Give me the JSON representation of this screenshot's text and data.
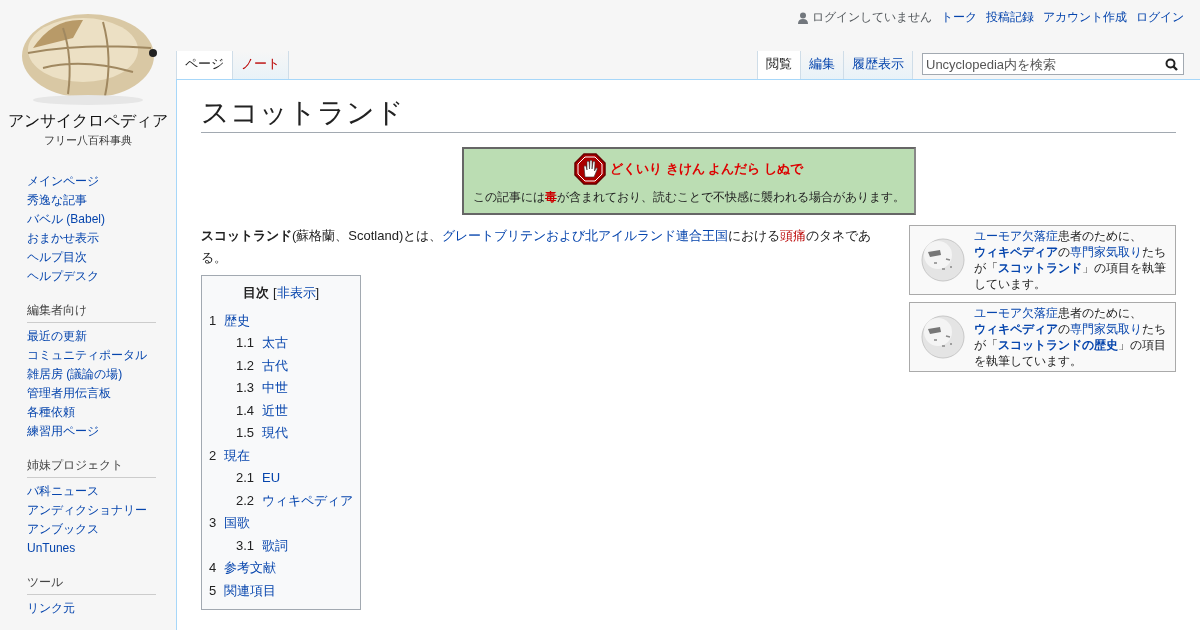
{
  "logo": {
    "title": "アンサイクロペディア",
    "subtitle": "フリー八百科事典"
  },
  "personal_tools": [
    {
      "label": "ログインしていません",
      "kind": "status"
    },
    {
      "label": "トーク",
      "kind": "link"
    },
    {
      "label": "投稿記録",
      "kind": "link"
    },
    {
      "label": "アカウント作成",
      "kind": "link"
    },
    {
      "label": "ログイン",
      "kind": "link"
    }
  ],
  "namespace_tabs": [
    {
      "label": "ページ",
      "selected": true,
      "exists": true
    },
    {
      "label": "ノート",
      "selected": false,
      "exists": false
    }
  ],
  "view_tabs": [
    {
      "label": "閲覧",
      "selected": true
    },
    {
      "label": "編集",
      "selected": false
    },
    {
      "label": "履歴表示",
      "selected": false
    }
  ],
  "search": {
    "placeholder": "Uncyclopedia内を検索"
  },
  "sidebar": {
    "main": [
      "メインページ",
      "秀逸な記事",
      "バベル (Babel)",
      "おまかせ表示",
      "ヘルプ目次",
      "ヘルプデスク"
    ],
    "sections": [
      {
        "heading": "編集者向け",
        "items": [
          "最近の更新",
          "コミュニティポータル",
          "雑居房 (議論の場)",
          "管理者用伝言板",
          "各種依頼",
          "練習用ページ"
        ]
      },
      {
        "heading": "姉妹プロジェクト",
        "items": [
          "バ科ニュース",
          "アンディクショナリー",
          "アンブックス",
          "UnTunes"
        ]
      },
      {
        "heading": "ツール",
        "items": [
          "リンク元"
        ]
      }
    ]
  },
  "title": "スコットランド",
  "warning": {
    "heading": "どくいり きけん よんだら しぬで",
    "text": "この記事には**毒**が含まれており、読むことで不快感に襲われる場合があります。"
  },
  "intro": [
    {
      "text": "スコットランド",
      "kind": "bold"
    },
    {
      "text": "(蘇格蘭、Scotland)とは、",
      "kind": "plain"
    },
    {
      "text": "グレートブリテンおよび北アイルランド連合王国",
      "kind": "link"
    },
    {
      "text": "における",
      "kind": "plain"
    },
    {
      "text": "頭痛",
      "kind": "redlink"
    },
    {
      "text": "のタネである。",
      "kind": "plain"
    }
  ],
  "notices": [
    [
      {
        "text": "ユーモア欠落症",
        "kind": "link"
      },
      {
        "text": "患者のために、",
        "kind": "plain"
      },
      {
        "text": "ウィキペディア",
        "kind": "boldlink"
      },
      {
        "text": "の",
        "kind": "plain"
      },
      {
        "text": "専門家気取り",
        "kind": "link"
      },
      {
        "text": "たちが「",
        "kind": "plain"
      },
      {
        "text": "スコットランド",
        "kind": "boldlink"
      },
      {
        "text": "」の項目を執筆しています。",
        "kind": "plain"
      }
    ],
    [
      {
        "text": "ユーモア欠落症",
        "kind": "link"
      },
      {
        "text": "患者のために、",
        "kind": "plain"
      },
      {
        "text": "ウィキペディア",
        "kind": "boldlink"
      },
      {
        "text": "の",
        "kind": "plain"
      },
      {
        "text": "専門家気取り",
        "kind": "link"
      },
      {
        "text": "たちが「",
        "kind": "plain"
      },
      {
        "text": "スコットランドの歴史",
        "kind": "boldlink"
      },
      {
        "text": "」の項目を執筆しています。",
        "kind": "plain"
      }
    ]
  ],
  "toc": {
    "title": "目次",
    "toggle_open": "[",
    "toggle": "非表示",
    "toggle_close": "]",
    "items": [
      {
        "number": "1",
        "text": "歴史",
        "children": [
          {
            "number": "1.1",
            "text": "太古"
          },
          {
            "number": "1.2",
            "text": "古代"
          },
          {
            "number": "1.3",
            "text": "中世"
          },
          {
            "number": "1.4",
            "text": "近世"
          },
          {
            "number": "1.5",
            "text": "現代"
          }
        ]
      },
      {
        "number": "2",
        "text": "現在",
        "children": [
          {
            "number": "2.1",
            "text": "EU"
          },
          {
            "number": "2.2",
            "text": "ウィキペディア"
          }
        ]
      },
      {
        "number": "3",
        "text": "国歌",
        "children": [
          {
            "number": "3.1",
            "text": "歌詞"
          }
        ]
      },
      {
        "number": "4",
        "text": "参考文献"
      },
      {
        "number": "5",
        "text": "関連項目"
      }
    ]
  }
}
